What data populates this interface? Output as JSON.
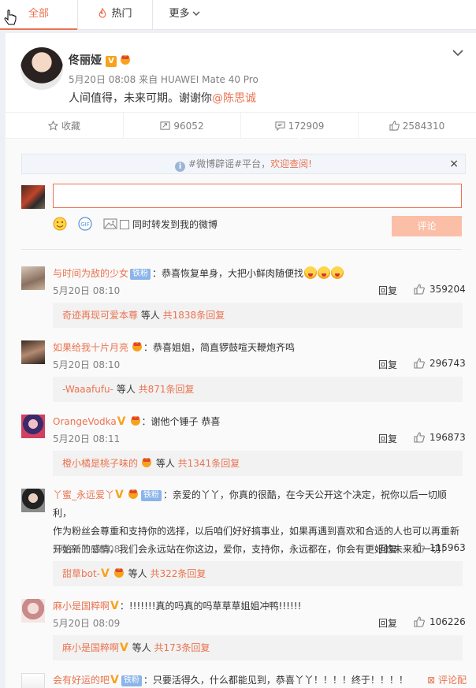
{
  "tabs": [
    {
      "label": "全部"
    },
    {
      "label": "热门"
    },
    {
      "label": "更多"
    }
  ],
  "post": {
    "author": "佟丽娅",
    "meta": "5月20日 08:08 来自 HUAWEI Mate 40 Pro",
    "text": "人间值得，未来可期。谢谢你",
    "mention": "@陈思诚",
    "actions": {
      "favorite": "收藏",
      "repost": "96052",
      "comment": "172909",
      "like": "2584310"
    }
  },
  "notice": {
    "text": "#微博辟谣#平台，",
    "highlight": "欢迎查阅!"
  },
  "composer": {
    "sync_label": "同时转发到我的微博",
    "submit": "评论"
  },
  "comments": [
    {
      "user": "与时间为敌的少女",
      "tag": "铁粉",
      "text": "：恭喜恢复单身，大把小鲜肉随便找",
      "time": "5月20日 08:10",
      "reply": "回复",
      "likes": "359204",
      "sub_user": "奇迹再现可爱本尊",
      "sub_mid": " 等人 ",
      "sub_count": "共1838条回复"
    },
    {
      "user": "如果给我十片月亮",
      "text": "：恭喜姐姐，简直锣鼓喧天鞭炮齐鸣",
      "time": "5月20日 08:10",
      "reply": "回复",
      "likes": "296743",
      "sub_user": "-Waaafufu-",
      "sub_mid": " 等人 ",
      "sub_count": "共871条回复"
    },
    {
      "user": "OrangeVodka",
      "text": "：谢他个锤子 恭喜",
      "time": "5月20日 08:11",
      "reply": "回复",
      "likes": "196873",
      "sub_user": "橙小橘是桃子味的",
      "sub_mid": " 等人 ",
      "sub_count": "共1341条回复"
    },
    {
      "user": "丫蜜_永远爱丫",
      "tag": "铁粉",
      "text": "：亲爱的丫丫，你真的很酷，在今天公开这个决定，祝你以后一切顺利，",
      "text2": "作为粉丝会尊重和支持你的选择，以后咱们好好搞事业，如果再遇到喜欢和合适的人也可以再重新",
      "text3": "开始新的感情，我们会永远站在你这边，爱你，支持你，永远都在，你会有更好的未来和一切！",
      "time": "5月20日 08:08",
      "reply": "回复",
      "likes": "115963",
      "sub_user": "甜草bot-",
      "sub_mid": " 等人 ",
      "sub_count": "共322条回复"
    },
    {
      "user": "麻小是国粹啊",
      "text": "：!!!!!!!真的吗真的吗草草草姐姐冲鸭!!!!!!",
      "time": "5月20日 08:09",
      "reply": "回复",
      "likes": "106226",
      "sub_user": "麻小是国粹啊",
      "sub_mid": " 等人 ",
      "sub_count": "共173条回复"
    },
    {
      "user": "会有好运的吧",
      "tag": "铁粉",
      "text": "：只要活得久，什么都能见到，恭喜丫丫！！！！终于！！！！",
      "report": "评论配"
    }
  ]
}
